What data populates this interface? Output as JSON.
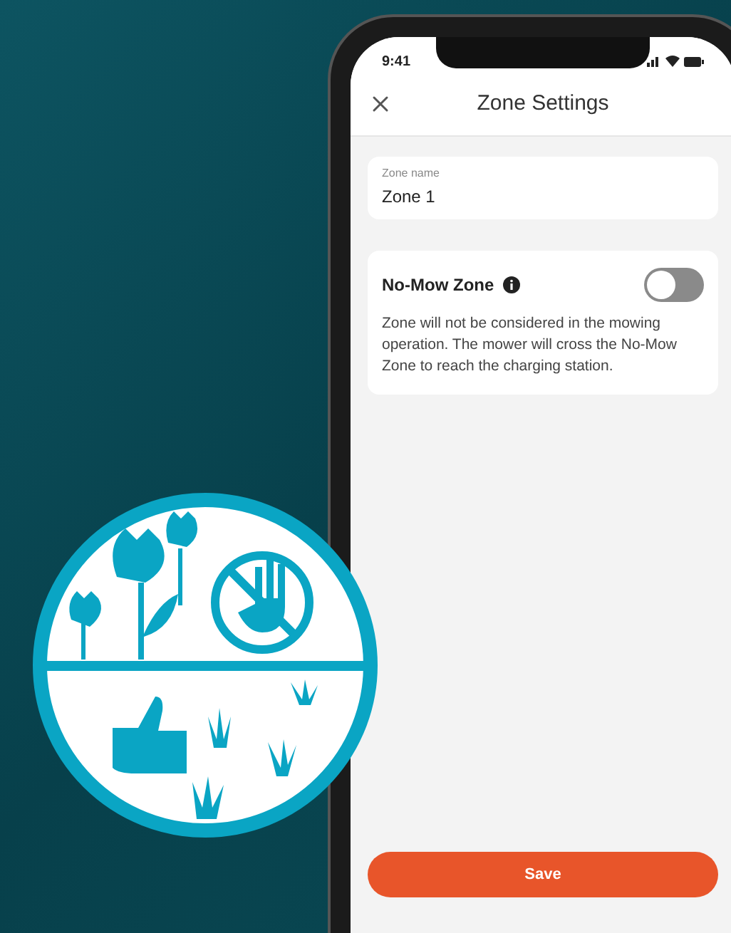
{
  "status_bar": {
    "time": "9:41"
  },
  "header": {
    "title": "Zone Settings"
  },
  "zone_name": {
    "label": "Zone name",
    "value": "Zone 1"
  },
  "no_mow_zone": {
    "title": "No-Mow Zone",
    "on": false,
    "description": "Zone will not be considered in the mowing operation. The mower will cross the No-Mow Zone to reach the charging station."
  },
  "save_button": {
    "label": "Save"
  }
}
